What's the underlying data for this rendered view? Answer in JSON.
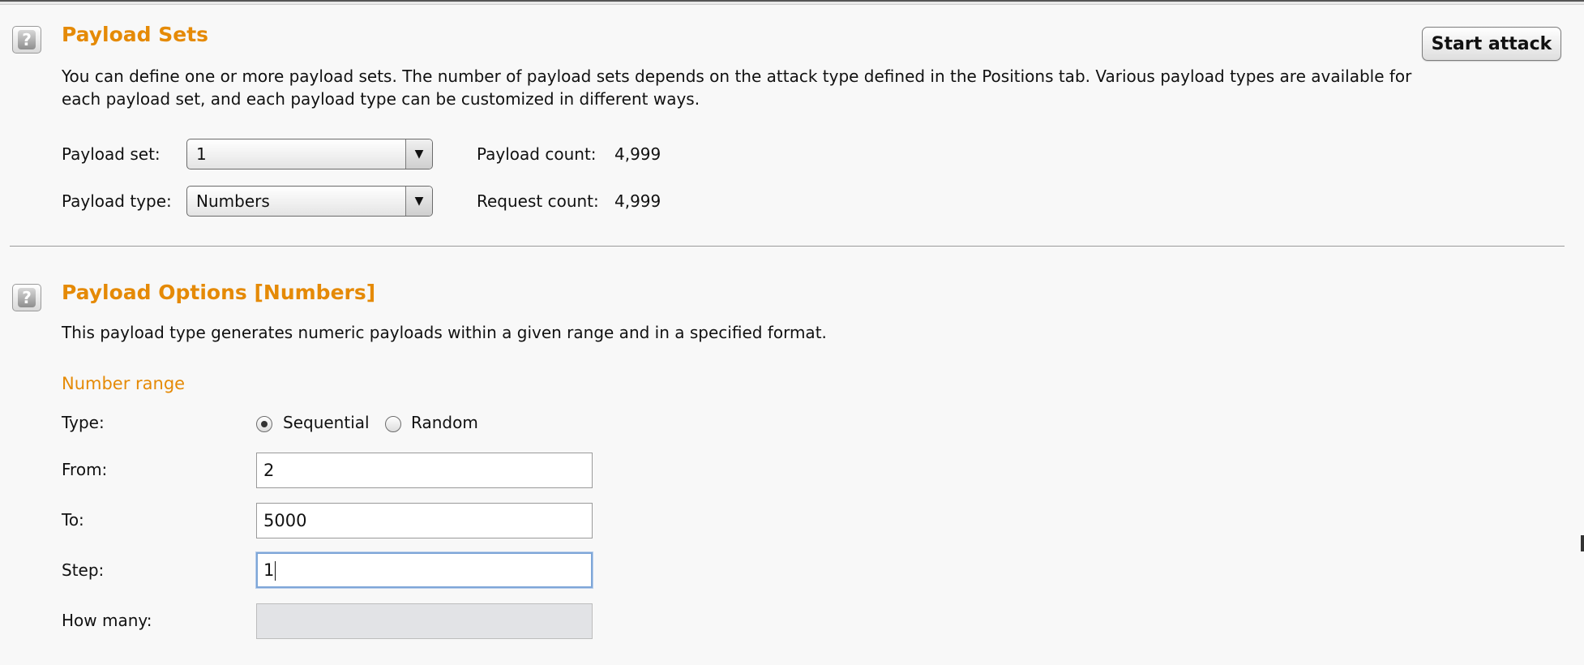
{
  "payload_sets": {
    "title": "Payload Sets",
    "description": "You can define one or more payload sets. The number of payload sets depends on the attack type defined in the Positions tab. Various payload types are available for each payload set, and each payload type can be customized in different ways.",
    "start_attack_label": "Start attack",
    "payload_set_label": "Payload set:",
    "payload_set_value": "1",
    "payload_type_label": "Payload type:",
    "payload_type_value": "Numbers",
    "payload_count_label": "Payload count:",
    "payload_count_value": "4,999",
    "request_count_label": "Request count:",
    "request_count_value": "4,999"
  },
  "payload_options": {
    "title": "Payload Options [Numbers]",
    "description": "This payload type generates numeric payloads within a given range and in a specified format.",
    "number_range_label": "Number range",
    "type_label": "Type:",
    "type_options": [
      "Sequential",
      "Random"
    ],
    "type_selected": "Sequential",
    "from_label": "From:",
    "from_value": "2",
    "to_label": "To:",
    "to_value": "5000",
    "step_label": "Step:",
    "step_value": "1",
    "how_many_label": "How many:",
    "how_many_value": ""
  },
  "icons": {
    "help": "help-icon",
    "dropdown": "chevron-down-icon"
  },
  "colors": {
    "accent": "#e58a06",
    "focus": "#7ea6d8",
    "background": "#f8f8f8"
  }
}
